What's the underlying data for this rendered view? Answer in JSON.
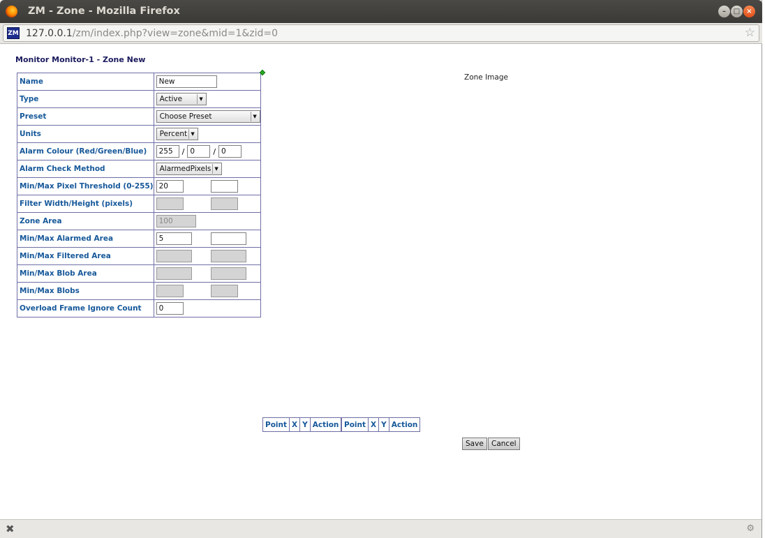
{
  "window": {
    "title": "ZM - Zone - Mozilla Firefox"
  },
  "urlbar": {
    "site_icon": "ZM",
    "host": "127.0.0.1",
    "path": "/zm/index.php?view=zone&mid=1&zid=0"
  },
  "page": {
    "heading": "Monitor Monitor-1 - Zone New",
    "zone_image_label": "Zone Image",
    "form": {
      "name": {
        "label": "Name",
        "value": "New"
      },
      "type": {
        "label": "Type",
        "value": "Active"
      },
      "preset": {
        "label": "Preset",
        "value": "Choose Preset"
      },
      "units": {
        "label": "Units",
        "value": "Percent"
      },
      "alarm_colour": {
        "label": "Alarm Colour (Red/Green/Blue)",
        "red": "255",
        "green": "0",
        "blue": "0",
        "separator": "/"
      },
      "alarm_check_method": {
        "label": "Alarm Check Method",
        "value": "AlarmedPixels"
      },
      "pixel_threshold": {
        "label": "Min/Max Pixel Threshold (0-255)",
        "min": "20",
        "max": ""
      },
      "filter_size": {
        "label": "Filter Width/Height (pixels)",
        "width": "",
        "height": ""
      },
      "zone_area": {
        "label": "Zone Area",
        "value": "100"
      },
      "alarmed_area": {
        "label": "Min/Max Alarmed Area",
        "min": "5",
        "max": ""
      },
      "filtered_area": {
        "label": "Min/Max Filtered Area",
        "min": "",
        "max": ""
      },
      "blob_area": {
        "label": "Min/Max Blob Area",
        "min": "",
        "max": ""
      },
      "blobs": {
        "label": "Min/Max Blobs",
        "min": "",
        "max": ""
      },
      "overload_frame_ignore": {
        "label": "Overload Frame Ignore Count",
        "value": "0"
      }
    },
    "points_tables": [
      {
        "headers": [
          "Point",
          "X",
          "Y",
          "Action"
        ]
      },
      {
        "headers": [
          "Point",
          "X",
          "Y",
          "Action"
        ]
      }
    ],
    "buttons": {
      "save": "Save",
      "cancel": "Cancel"
    }
  },
  "icons": {
    "browser_logo": "firefox-logo",
    "bookmark": "star-icon",
    "status_close": "close-icon",
    "status_addon": "addon-icon"
  }
}
